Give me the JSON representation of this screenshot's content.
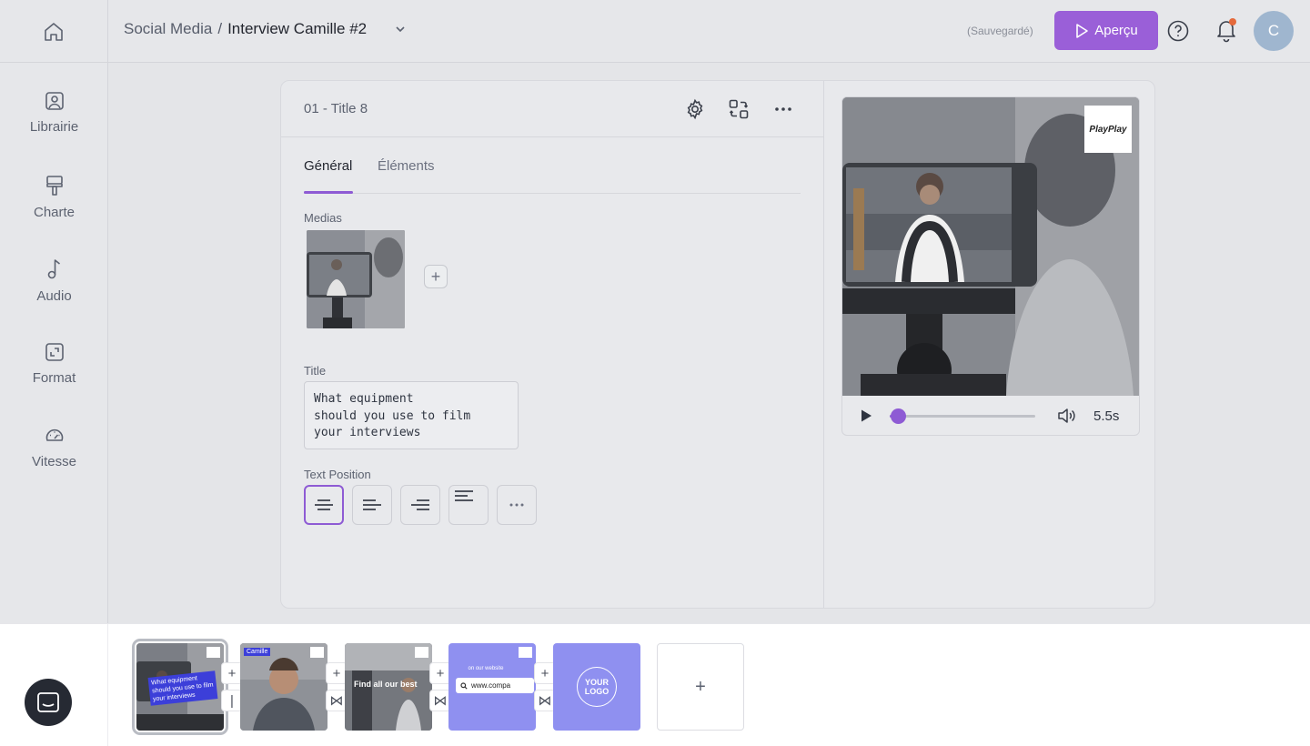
{
  "header": {
    "project": "Social Media",
    "separator": "/",
    "current": "Interview Camille #2",
    "saved_status": "(Sauvegardé)",
    "preview_label": "Aperçu",
    "avatar_initial": "C",
    "accent_color": "#9a5fd8",
    "notification_dot_color": "#e56a3b"
  },
  "sidebar": {
    "items": [
      {
        "label": "Librairie",
        "icon": "image-icon"
      },
      {
        "label": "Charte",
        "icon": "paint-roller-icon"
      },
      {
        "label": "Audio",
        "icon": "music-note-icon"
      },
      {
        "label": "Format",
        "icon": "resize-icon"
      },
      {
        "label": "Vitesse",
        "icon": "speedometer-icon"
      }
    ]
  },
  "scene": {
    "title": "01 - Title 8",
    "tabs": [
      {
        "label": "Général",
        "active": true
      },
      {
        "label": "Éléments",
        "active": false
      }
    ],
    "medias_label": "Medias",
    "title_label": "Title",
    "title_value": "What equipment\nshould you use to film\nyour interviews",
    "text_position_label": "Text Position",
    "text_positions": [
      "center",
      "left",
      "right",
      "top",
      "more"
    ]
  },
  "preview": {
    "logo_text": "PlayPlay",
    "duration": "5.5s",
    "progress": 0.06
  },
  "timeline": {
    "slides": [
      {
        "caption": "What equipment should you use to film your interviews",
        "type": "video"
      },
      {
        "caption": "Camille",
        "type": "video"
      },
      {
        "caption": "Find all our best",
        "type": "video"
      },
      {
        "caption": "on our website",
        "url_text": "www.compa",
        "type": "color"
      },
      {
        "caption": "YOUR LOGO",
        "type": "color"
      }
    ],
    "add_label": "+",
    "slide_color": "#8f90f0"
  }
}
